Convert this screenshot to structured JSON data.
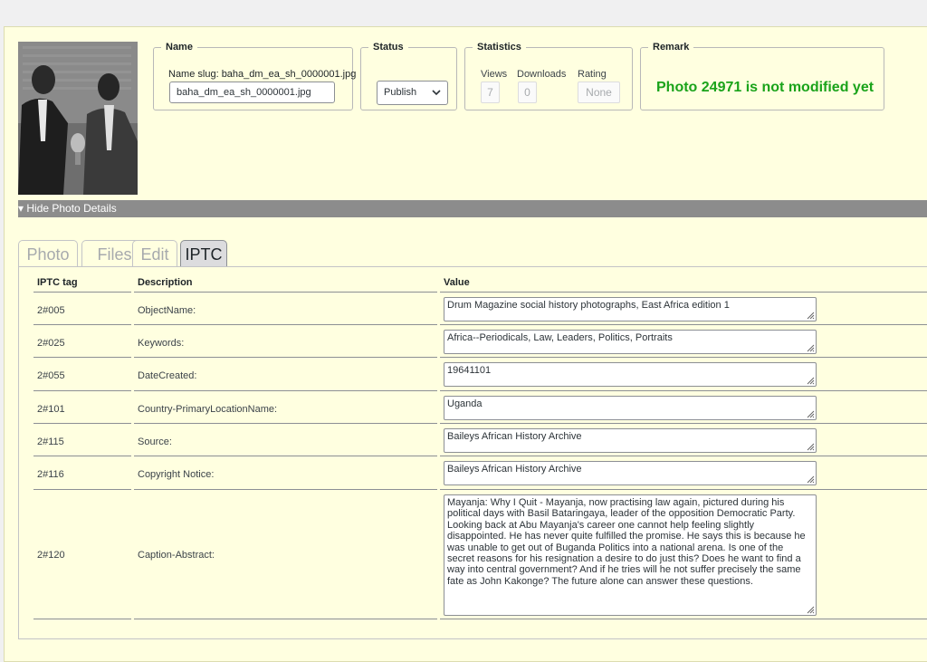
{
  "header": {
    "name_legend": "Name",
    "slug_label": "Name slug: baha_dm_ea_sh_0000001.jpg",
    "slug_value": "baha_dm_ea_sh_0000001.jpg",
    "status_legend": "Status",
    "status_value": "Publish",
    "statistics_legend": "Statistics",
    "views_label": "Views",
    "views_value": "7",
    "downloads_label": "Downloads",
    "downloads_value": "0",
    "rating_label": "Rating",
    "rating_value": "None",
    "remark_legend": "Remark",
    "remark_text": "Photo 24971 is not modified yet"
  },
  "toggle": {
    "label": "▾ Hide Photo Details"
  },
  "tabs": [
    {
      "label": "Photo",
      "active": false
    },
    {
      "label": "Files",
      "active": false
    },
    {
      "label": "Edit",
      "active": false
    },
    {
      "label": "IPTC",
      "active": true
    }
  ],
  "table": {
    "headers": [
      "IPTC tag",
      "Description",
      "Value"
    ],
    "rows": [
      {
        "tag": "2#005",
        "desc": "ObjectName:",
        "value": "Drum Magazine social history photographs, East Africa edition 1"
      },
      {
        "tag": "2#025",
        "desc": "Keywords:",
        "value": "Africa--Periodicals, Law, Leaders, Politics, Portraits"
      },
      {
        "tag": "2#055",
        "desc": "DateCreated:",
        "value": "19641101"
      },
      {
        "tag": "2#101",
        "desc": "Country-PrimaryLocationName:",
        "value": "Uganda"
      },
      {
        "tag": "2#115",
        "desc": "Source:",
        "value": "Baileys African History Archive"
      },
      {
        "tag": "2#116",
        "desc": "Copyright Notice:",
        "value": "Baileys African History Archive"
      },
      {
        "tag": "2#120",
        "desc": "Caption-Abstract:",
        "value": "Mayanja: Why I Quit - Mayanja, now practising law again, pictured during his political days with Basil Bataringaya, leader of the opposition Democratic Party. Looking back at Abu Mayanja's career one cannot help feeling slightly disappointed. He has never quite fulfilled the promise. He says this is because he was unable to get out of Buganda Politics into a national arena. Is one of the secret reasons for his resignation a desire to do just this? Does he want to find a way into central government? And if he tries will he not suffer precisely the same fate as John Kakonge? The future alone can answer these questions."
      }
    ]
  },
  "colors": {
    "panel_bg": "#ffffe0",
    "remark_green": "#1aa31a",
    "toggle_bar": "#8c8c8c"
  }
}
